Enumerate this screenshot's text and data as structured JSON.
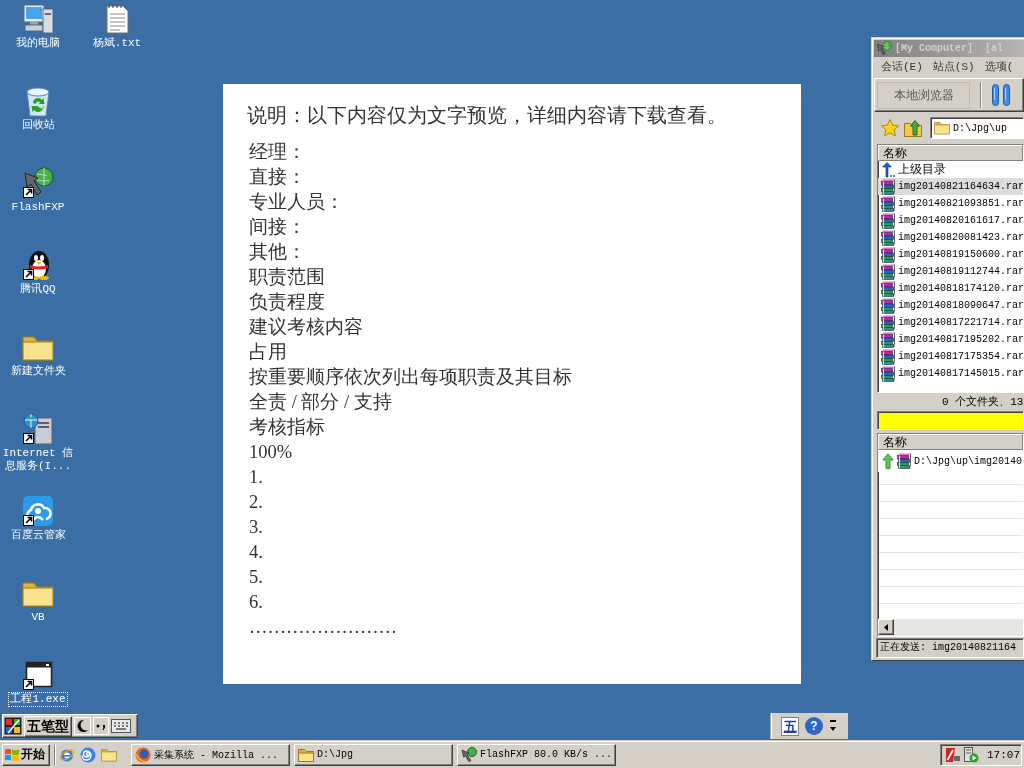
{
  "desktop": {
    "icon_columns": [
      {
        "icons": [
          {
            "label": "我的电脑",
            "kind": "computer",
            "shortcut": false,
            "focused": false
          },
          {
            "label": "回收站",
            "kind": "recycle-bin",
            "shortcut": false,
            "focused": false
          },
          {
            "label": "FlashFXP",
            "kind": "ftp",
            "shortcut": true,
            "focused": false
          },
          {
            "label": "腾讯QQ",
            "kind": "penguin",
            "shortcut": true,
            "focused": false
          },
          {
            "label": "新建文件夹",
            "kind": "folder",
            "shortcut": false,
            "focused": false
          },
          {
            "label": "Internet 信息服务(I...",
            "kind": "server",
            "shortcut": true,
            "focused": false
          },
          {
            "label": "百度云管家",
            "kind": "cloud",
            "shortcut": true,
            "focused": false
          },
          {
            "label": "VB",
            "kind": "folder",
            "shortcut": false,
            "focused": false
          },
          {
            "label": "工程1.exe",
            "kind": "program",
            "shortcut": true,
            "focused": true
          }
        ]
      },
      {
        "icons": [
          {
            "label": "杨斌.txt",
            "kind": "text-file",
            "shortcut": false,
            "focused": false
          }
        ]
      }
    ]
  },
  "document": {
    "title": "说明：以下内容仅为文字预览，详细内容请下载查看。",
    "lines": [
      "经理：",
      "直接：",
      "专业人员：",
      "间接：",
      "其他：",
      "职责范围",
      "负责程度",
      "建议考核内容",
      "占用",
      "按重要顺序依次列出每项职责及其目标",
      "全责 / 部分 / 支持",
      "考核指标",
      "100%",
      "1.",
      "2.",
      "3.",
      "4.",
      "5.",
      "6.",
      "……………………"
    ]
  },
  "ftp_window": {
    "title": "[My Computer]  [al",
    "active": false,
    "menu": [
      "会话(E)",
      "站点(S)",
      "选项("
    ],
    "toolbar_button": "本地浏览器",
    "path": "D:\\Jpg\\up",
    "file_list": {
      "column": "名称",
      "rows": [
        {
          "name": "上级目录",
          "kind": "parent",
          "selected": false
        },
        {
          "name": "img20140821164634.rar",
          "kind": "archive",
          "selected": true
        },
        {
          "name": "img20140821093851.rar",
          "kind": "archive",
          "selected": false
        },
        {
          "name": "img20140820161617.rar",
          "kind": "archive",
          "selected": false
        },
        {
          "name": "img20140820081423.rar",
          "kind": "archive",
          "selected": false
        },
        {
          "name": "img20140819150600.rar",
          "kind": "archive",
          "selected": false
        },
        {
          "name": "img20140819112744.rar",
          "kind": "archive",
          "selected": false
        },
        {
          "name": "img20140818174120.rar",
          "kind": "archive",
          "selected": false
        },
        {
          "name": "img20140818090647.rar",
          "kind": "archive",
          "selected": false
        },
        {
          "name": "img20140817221714.rar",
          "kind": "archive",
          "selected": false
        },
        {
          "name": "img20140817195202.rar",
          "kind": "archive",
          "selected": false
        },
        {
          "name": "img20140817175354.rar",
          "kind": "archive",
          "selected": false
        },
        {
          "name": "img20140817145015.rar",
          "kind": "archive",
          "selected": false
        }
      ]
    },
    "summary": "0 个文件夹、13",
    "queue": {
      "column": "名称",
      "rows": [
        {
          "name": "D:\\Jpg\\up\\img20140",
          "kind": "upload"
        }
      ]
    },
    "status": "正在发送: img20140821164"
  },
  "ime_bar": {
    "mode": "五笔型"
  },
  "language_bar": {
    "mode": "五",
    "help": "?"
  },
  "taskbar": {
    "start": "开始",
    "tasks": [
      {
        "label": "采集系统 - Mozilla ...",
        "kind": "browser",
        "selected": false
      },
      {
        "label": "D:\\Jpg",
        "kind": "folder",
        "selected": false
      },
      {
        "label": "FlashFXP 80.0 KB/s ...",
        "kind": "ftp",
        "selected": false
      }
    ],
    "clock": "17:07"
  }
}
